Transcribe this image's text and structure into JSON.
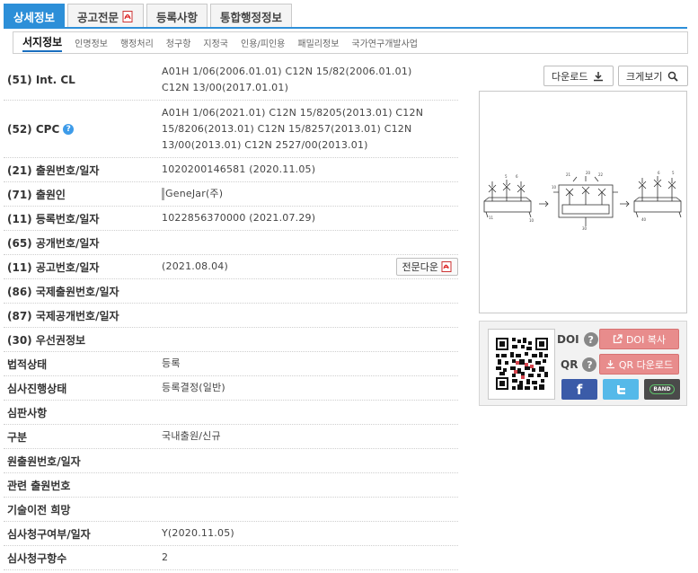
{
  "tabs": [
    {
      "label": "상세정보",
      "active": true
    },
    {
      "label": "공고전문",
      "active": false,
      "pdf": true
    },
    {
      "label": "등록사항",
      "active": false
    },
    {
      "label": "통합행정정보",
      "active": false
    }
  ],
  "subtabs": [
    "서지정보",
    "인명정보",
    "행정처리",
    "청구항",
    "지정국",
    "인용/피인용",
    "패밀리정보",
    "국가연구개발사업"
  ],
  "fields": [
    {
      "key": "(51) Int. CL",
      "lines": [
        "A01H 1/06(2006.01.01) C12N 15/82(2006.01.01)",
        "C12N 13/00(2017.01.01)"
      ]
    },
    {
      "key": "(52) CPC",
      "help": true,
      "lines": [
        "A01H 1/06(2021.01) C12N 15/8205(2013.01) C12N",
        "15/8206(2013.01) C12N 15/8257(2013.01) C12N",
        "13/00(2013.01) C12N 2527/00(2013.01)"
      ]
    },
    {
      "key": "(21) 출원번호/일자",
      "lines": [
        "1020200146581 (2020.11.05)"
      ]
    },
    {
      "key": "(71) 출원인",
      "lines": [
        "GeneJar(주)"
      ],
      "bar": true
    },
    {
      "key": "(11) 등록번호/일자",
      "lines": [
        "1022856370000 (2021.07.29)"
      ]
    },
    {
      "key": "(65) 공개번호/일자",
      "lines": [
        ""
      ]
    },
    {
      "key": "(11) 공고번호/일자",
      "lines": [
        "(2021.08.04)"
      ],
      "fulltext": "전문다운"
    },
    {
      "key": "(86) 국제출원번호/일자",
      "lines": [
        ""
      ]
    },
    {
      "key": "(87) 국제공개번호/일자",
      "lines": [
        ""
      ]
    },
    {
      "key": "(30) 우선권정보",
      "lines": [
        ""
      ]
    },
    {
      "key": "법적상태",
      "lines": [
        "등록"
      ]
    },
    {
      "key": "심사진행상태",
      "lines": [
        "등록결정(일반)"
      ]
    },
    {
      "key": "심판사항",
      "lines": [
        ""
      ]
    },
    {
      "key": "구분",
      "lines": [
        "국내출원/신규"
      ]
    },
    {
      "key": "원출원번호/일자",
      "lines": [
        ""
      ]
    },
    {
      "key": "관련 출원번호",
      "lines": [
        ""
      ]
    },
    {
      "key": "기술이전 희망",
      "lines": [
        ""
      ]
    },
    {
      "key": "심사청구여부/일자",
      "lines": [
        "Y(2020.11.05)"
      ]
    },
    {
      "key": "심사청구항수",
      "lines": [
        "2"
      ]
    }
  ],
  "panel": {
    "download_label": "다운로드",
    "zoom_label": "크게보기",
    "doi_label": "DOI",
    "qr_label": "QR",
    "doi_copy_label": "DOI 복사",
    "qr_download_label": "QR 다운로드",
    "band_label": "BAND"
  },
  "colors": {
    "accent": "#2d8fd8",
    "doi_button": "#e88c8c",
    "facebook": "#3b5ba8",
    "twitter": "#55b9e9",
    "band": "#4a4a4a"
  }
}
